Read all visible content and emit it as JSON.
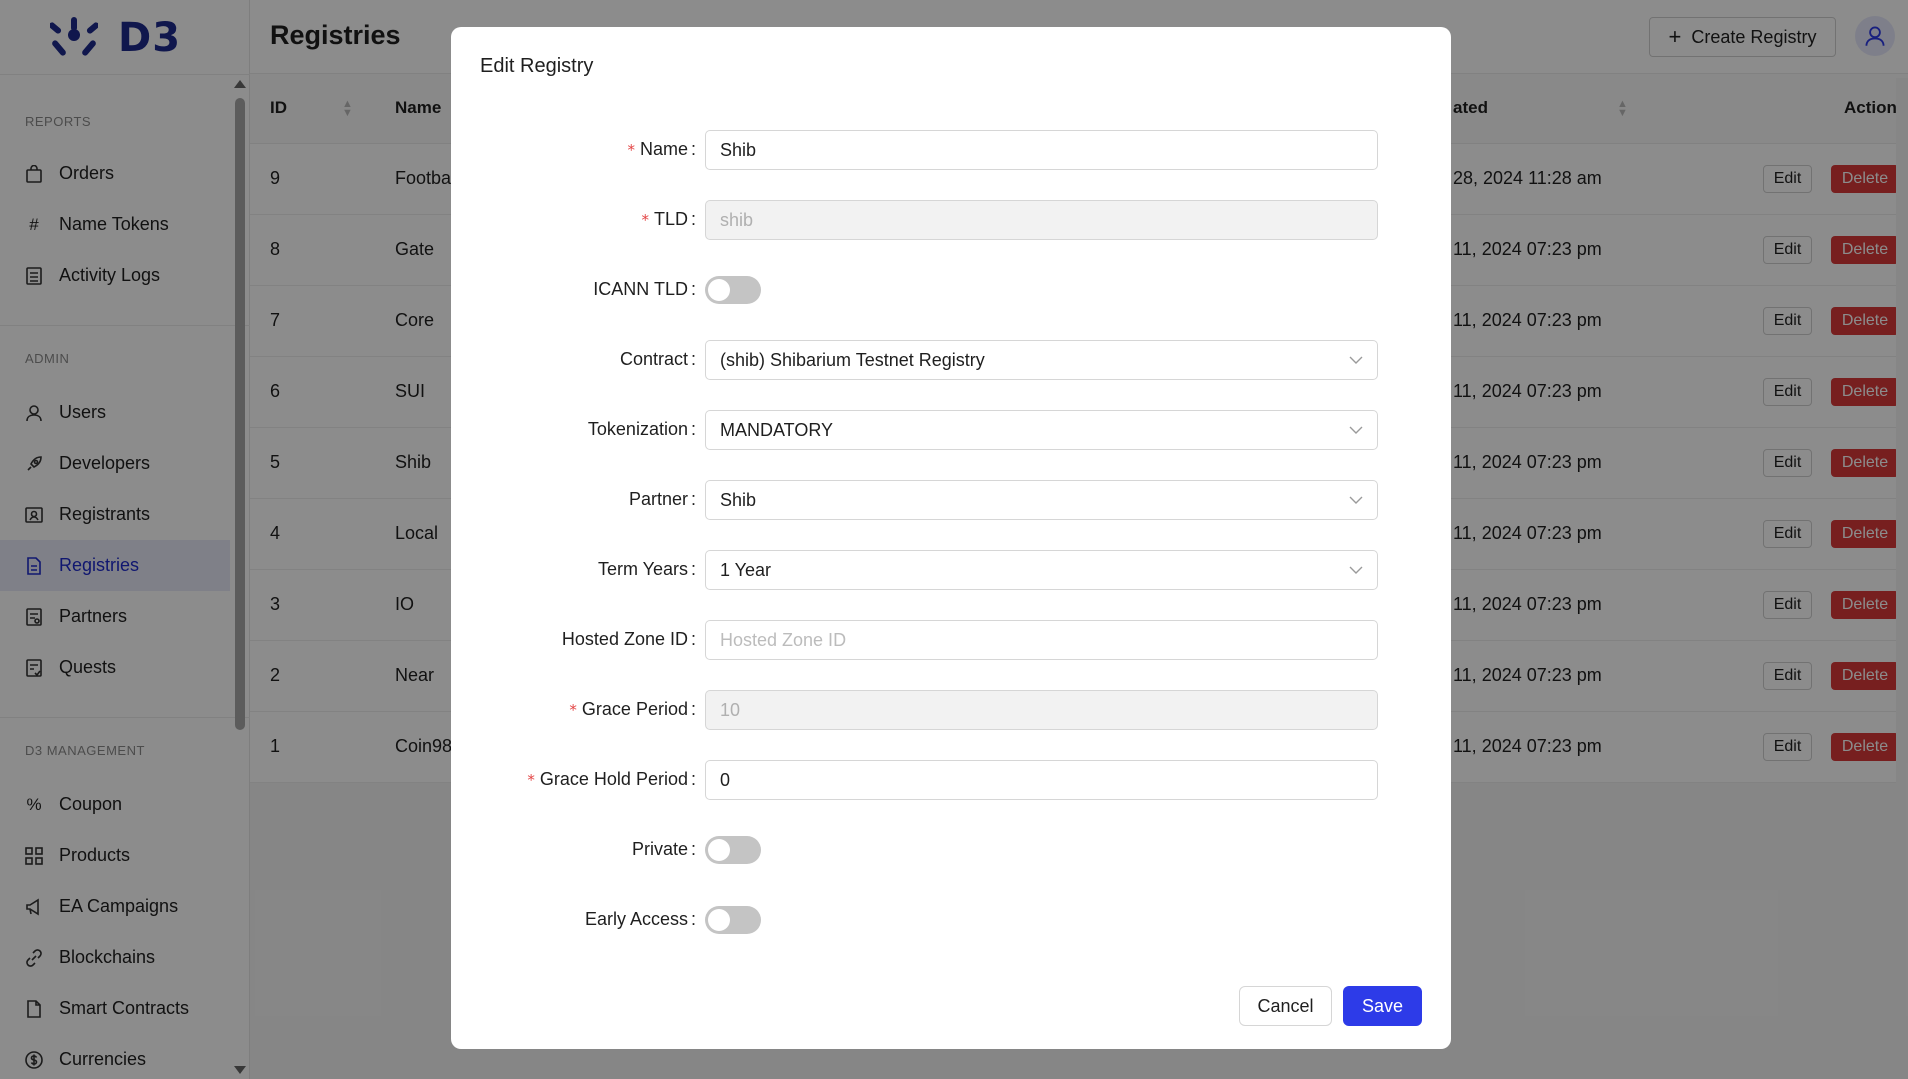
{
  "brand": {
    "name": "D3"
  },
  "sidebar": {
    "sections": [
      {
        "label": "REPORTS",
        "items": [
          {
            "label": "Orders",
            "icon": "shopping-bag-icon"
          },
          {
            "label": "Name Tokens",
            "icon": "hash-icon"
          },
          {
            "label": "Activity Logs",
            "icon": "log-icon"
          }
        ]
      },
      {
        "label": "ADMIN",
        "items": [
          {
            "label": "Users",
            "icon": "user-icon"
          },
          {
            "label": "Developers",
            "icon": "rocket-icon"
          },
          {
            "label": "Registrants",
            "icon": "id-card-icon"
          },
          {
            "label": "Registries",
            "icon": "document-icon",
            "active": true
          },
          {
            "label": "Partners",
            "icon": "partner-icon"
          },
          {
            "label": "Quests",
            "icon": "quest-icon"
          }
        ]
      },
      {
        "label": "D3 MANAGEMENT",
        "items": [
          {
            "label": "Coupon",
            "icon": "percent-icon"
          },
          {
            "label": "Products",
            "icon": "grid-icon"
          },
          {
            "label": "EA Campaigns",
            "icon": "megaphone-icon"
          },
          {
            "label": "Blockchains",
            "icon": "link-icon"
          },
          {
            "label": "Smart Contracts",
            "icon": "file-icon"
          },
          {
            "label": "Currencies",
            "icon": "dollar-icon"
          }
        ]
      }
    ]
  },
  "header": {
    "title": "Registries",
    "create_label": "Create Registry"
  },
  "table": {
    "columns": {
      "id": "ID",
      "name": "Name",
      "updated": "ated",
      "actions": "Actions"
    },
    "rows": [
      {
        "id": "9",
        "name": "Footbal",
        "date": "28, 2024 11:28 am"
      },
      {
        "id": "8",
        "name": "Gate",
        "date": "11, 2024 07:23 pm"
      },
      {
        "id": "7",
        "name": "Core",
        "date": "11, 2024 07:23 pm"
      },
      {
        "id": "6",
        "name": "SUI",
        "date": "11, 2024 07:23 pm"
      },
      {
        "id": "5",
        "name": "Shib",
        "date": "11, 2024 07:23 pm"
      },
      {
        "id": "4",
        "name": "Local",
        "date": "11, 2024 07:23 pm"
      },
      {
        "id": "3",
        "name": "IO",
        "date": "11, 2024 07:23 pm"
      },
      {
        "id": "2",
        "name": "Near",
        "date": "11, 2024 07:23 pm"
      },
      {
        "id": "1",
        "name": "Coin98",
        "date": "11, 2024 07:23 pm"
      }
    ],
    "edit_label": "Edit",
    "delete_label": "Delete"
  },
  "modal": {
    "title": "Edit Registry",
    "fields": {
      "name": {
        "label": "Name",
        "value": "Shib"
      },
      "tld": {
        "label": "TLD",
        "value": "shib"
      },
      "icann": {
        "label": "ICANN TLD"
      },
      "contract": {
        "label": "Contract",
        "value": "(shib) Shibarium Testnet Registry"
      },
      "tokenization": {
        "label": "Tokenization",
        "value": "MANDATORY"
      },
      "partner": {
        "label": "Partner",
        "value": "Shib"
      },
      "term_years": {
        "label": "Term Years",
        "value": "1 Year"
      },
      "hosted_zone": {
        "label": "Hosted Zone ID",
        "placeholder": "Hosted Zone ID"
      },
      "grace_period": {
        "label": "Grace Period",
        "value": "10"
      },
      "grace_hold": {
        "label": "Grace Hold Period",
        "value": "0"
      },
      "private": {
        "label": "Private"
      },
      "early_access": {
        "label": "Early Access"
      }
    },
    "cancel_label": "Cancel",
    "save_label": "Save"
  }
}
